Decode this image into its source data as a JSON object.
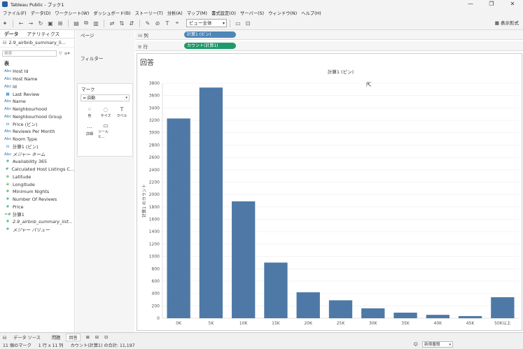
{
  "window": {
    "title": "Tableau Public - ブック1",
    "controls": [
      "—",
      "❐",
      "✕"
    ]
  },
  "menubar": [
    "ファイル(F)",
    "データ(D)",
    "ワークシート(W)",
    "ダッシュボード(B)",
    "ストーリー(T)",
    "分析(A)",
    "マップ(M)",
    "書式設定(O)",
    "サーバー(S)",
    "ウィンドウ(N)",
    "ヘルプ(H)"
  ],
  "toolbar": {
    "view_select": "ビュー全体",
    "show_me": "表示形式"
  },
  "data_pane": {
    "tabs": [
      "データ",
      "アナリティクス"
    ],
    "datasource": "2.9_airbnb_summary_li...",
    "search_placeholder": "検索",
    "section": "表",
    "fields": [
      {
        "type": "Abc",
        "kind": "dim",
        "label": "Host Id"
      },
      {
        "type": "Abc",
        "kind": "dim",
        "label": "Host Name"
      },
      {
        "type": "Abc",
        "kind": "dim",
        "label": "Id"
      },
      {
        "type": "▦",
        "kind": "dim",
        "label": "Last Review"
      },
      {
        "type": "Abc",
        "kind": "dim",
        "label": "Name"
      },
      {
        "type": "Abc",
        "kind": "dim",
        "label": "Neighbourhood"
      },
      {
        "type": "Abc",
        "kind": "dim",
        "label": "Neighbourhood Group"
      },
      {
        "type": "ılı",
        "kind": "dim",
        "label": "Price (ビン)"
      },
      {
        "type": "Abc",
        "kind": "dim",
        "label": "Reviews Per Month"
      },
      {
        "type": "Abc",
        "kind": "dim",
        "label": "Room Type"
      },
      {
        "type": "ılı",
        "kind": "dim",
        "label": "計算1 (ビン)"
      },
      {
        "type": "Abc",
        "kind": "dim",
        "label": "メジャー ネーム",
        "italic": true
      },
      {
        "type": "#",
        "kind": "meas",
        "label": "Availability 365"
      },
      {
        "type": "#",
        "kind": "meas",
        "label": "Calculated Host Listings C..."
      },
      {
        "type": "⊕",
        "kind": "meas",
        "label": "Latitude"
      },
      {
        "type": "⊕",
        "kind": "meas",
        "label": "Longitude"
      },
      {
        "type": "#",
        "kind": "meas",
        "label": "Minimum Nights"
      },
      {
        "type": "#",
        "kind": "meas",
        "label": "Number Of Reviews"
      },
      {
        "type": "#",
        "kind": "meas",
        "label": "Price"
      },
      {
        "type": "=#",
        "kind": "meas",
        "label": "計算1"
      },
      {
        "type": "#",
        "kind": "meas",
        "label": "2.9_airbnb_summary_list...",
        "italic": true
      },
      {
        "type": "#",
        "kind": "meas",
        "label": "メジャー バリュー",
        "italic": true
      }
    ]
  },
  "cards": {
    "pages": "ページ",
    "filters": "フィルター",
    "marks": "マーク",
    "mark_type": "自動",
    "mark_buttons": [
      {
        "icon": "⁘",
        "label": "色"
      },
      {
        "icon": "◌",
        "label": "サイズ"
      },
      {
        "icon": "T",
        "label": "ラベル"
      },
      {
        "icon": "⋯",
        "label": "詳細"
      },
      {
        "icon": "▭",
        "label": "ツールヒ..."
      }
    ]
  },
  "shelves": {
    "columns_label": "列",
    "columns_pill": "計算1 (ビン)",
    "rows_label": "行",
    "rows_pill": "カウント(計算1)"
  },
  "sheet": {
    "title": "回答"
  },
  "chart_data": {
    "type": "bar",
    "title": "計算1 (ビン)",
    "xlabel": "",
    "ylabel": "計算1 のカウント",
    "categories": [
      "0K",
      "5K",
      "10K",
      "15K",
      "20K",
      "25K",
      "30K",
      "35K",
      "40K",
      "45K",
      "50K以上"
    ],
    "values": [
      3230,
      3730,
      1890,
      900,
      420,
      290,
      160,
      90,
      55,
      35,
      340
    ],
    "ylim": [
      0,
      3800
    ],
    "yticks": [
      0,
      200,
      400,
      600,
      800,
      1000,
      1200,
      1400,
      1600,
      1800,
      2000,
      2200,
      2400,
      2600,
      2800,
      3000,
      3200,
      3400,
      3600,
      3800
    ],
    "bar_color": "#4e79a7",
    "grid": true
  },
  "bottom_tabs": {
    "datasource": "データ ソース",
    "sheet1": "問題",
    "sheet2": "回答"
  },
  "status": {
    "marks": "11 個のマーク",
    "rows_cols": "1 行 x 11 列",
    "sum": "カウント(計算1) の合計: 11,197",
    "user": "新宿番頭"
  }
}
